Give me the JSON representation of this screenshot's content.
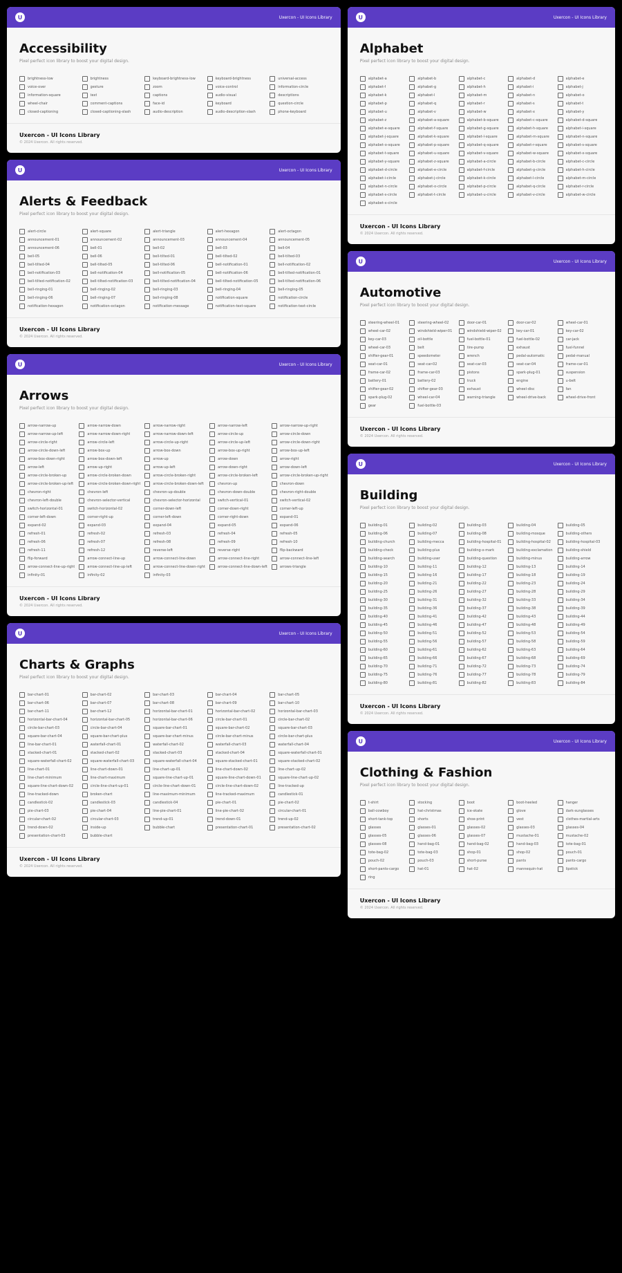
{
  "brand": "Uxercon - UI Icons Library",
  "sub": "Pixel perfect icon library to boost your digital design.",
  "footer_title": "Uxercon - UI Icons Library",
  "footer_copy": "© 2024 Uxercon. All rights reserved.",
  "panels": [
    {
      "title": "Accessibility",
      "items": [
        "brightness-low",
        "brightness",
        "keyboard-brightness-low",
        "keyboard-brightness",
        "universal-access",
        "voice-over",
        "gesture",
        "zoom",
        "voice-control",
        "information-circle",
        "information-square",
        "text",
        "captions",
        "audio-visual",
        "descriptions",
        "wheel-chair",
        "comment-captions",
        "face-id",
        "keyboard",
        "question-circle",
        "closed-captioning",
        "closed-captioning-slash",
        "audio-description",
        "audio-description-slash",
        "phone-keyboard"
      ]
    },
    {
      "title": "Alerts & Feedback",
      "items": [
        "alert-circle",
        "alert-square",
        "alert-triangle",
        "alert-hexagon",
        "alert-octagon",
        "announcement-01",
        "announcement-02",
        "announcement-03",
        "announcement-04",
        "announcement-05",
        "announcement-06",
        "bell-01",
        "bell-02",
        "bell-03",
        "bell-04",
        "bell-05",
        "bell-06",
        "bell-tilted-01",
        "bell-tilted-02",
        "bell-tilted-03",
        "bell-tilted-04",
        "bell-tilted-05",
        "bell-tilted-06",
        "bell-notification-01",
        "bell-notification-02",
        "bell-notification-03",
        "bell-notification-04",
        "bell-notification-05",
        "bell-notification-06",
        "bell-tilted-notification-01",
        "bell-tilted-notification-02",
        "bell-tilted-notification-03",
        "bell-tilted-notification-04",
        "bell-tilted-notification-05",
        "bell-tilted-notification-06",
        "bell-ringing-01",
        "bell-ringing-02",
        "bell-ringing-03",
        "bell-ringing-04",
        "bell-ringing-05",
        "bell-ringing-06",
        "bell-ringing-07",
        "bell-ringing-08",
        "notification-square",
        "notification-circle",
        "notification-hexagon",
        "notification-octagon",
        "notification-message",
        "notification-text-square",
        "notification-text-circle"
      ]
    },
    {
      "title": "Arrows",
      "items": [
        "arrow-narrow-up",
        "arrow-narrow-down",
        "arrow-narrow-right",
        "arrow-narrow-left",
        "arrow-narrow-up-right",
        "arrow-narrow-up-left",
        "arrow-narrow-down-right",
        "arrow-narrow-down-left",
        "arrow-circle-up",
        "arrow-circle-down",
        "arrow-circle-right",
        "arrow-circle-left",
        "arrow-circle-up-right",
        "arrow-circle-up-left",
        "arrow-circle-down-right",
        "arrow-circle-down-left",
        "arrow-box-up",
        "arrow-box-down",
        "arrow-box-up-right",
        "arrow-box-up-left",
        "arrow-box-down-right",
        "arrow-box-down-left",
        "arrow-up",
        "arrow-down",
        "arrow-right",
        "arrow-left",
        "arrow-up-right",
        "arrow-up-left",
        "arrow-down-right",
        "arrow-down-left",
        "arrow-circle-broken-up",
        "arrow-circle-broken-down",
        "arrow-circle-broken-right",
        "arrow-circle-broken-left",
        "arrow-circle-broken-up-right",
        "arrow-circle-broken-up-left",
        "arrow-circle-broken-down-right",
        "arrow-circle-broken-down-left",
        "chevron-up",
        "chevron-down",
        "chevron-right",
        "chevron-left",
        "chevron-up-double",
        "chevron-down-double",
        "chevron-right-double",
        "chevron-left-double",
        "chevron-selector-vertical",
        "chevron-selector-horizontal",
        "switch-vertical-01",
        "switch-vertical-02",
        "switch-horizontal-01",
        "switch-horizontal-02",
        "corner-down-left",
        "corner-down-right",
        "corner-left-up",
        "corner-left-down",
        "corner-right-up",
        "corner-left-down",
        "corner-right-down",
        "expand-01",
        "expand-02",
        "expand-03",
        "expand-04",
        "expand-05",
        "expand-06",
        "refresh-01",
        "refresh-02",
        "refresh-03",
        "refresh-04",
        "refresh-05",
        "refresh-06",
        "refresh-07",
        "refresh-08",
        "refresh-09",
        "refresh-10",
        "refresh-11",
        "refresh-12",
        "reverse-left",
        "reverse-right",
        "flip-backward",
        "flip-forward",
        "arrow-connect-line-up",
        "arrow-connect-line-down",
        "arrow-connect-line-right",
        "arrow-connect-line-left",
        "arrow-connect-line-up-right",
        "arrow-connect-line-up-left",
        "arrow-connect-line-down-right",
        "arrow-connect-line-down-left",
        "arrows-triangle",
        "infinity-01",
        "infinity-02",
        "infinity-03"
      ]
    },
    {
      "title": "Charts & Graphs",
      "items": [
        "bar-chart-01",
        "bar-chart-02",
        "bar-chart-03",
        "bar-chart-04",
        "bar-chart-05",
        "bar-chart-06",
        "bar-chart-07",
        "bar-chart-08",
        "bar-chart-09",
        "bar-chart-10",
        "bar-chart-11",
        "bar-chart-12",
        "horizontal-bar-chart-01",
        "horizontal-bar-chart-02",
        "horizontal-bar-chart-03",
        "horizontal-bar-chart-04",
        "horizontal-bar-chart-05",
        "horizontal-bar-chart-06",
        "circle-bar-chart-01",
        "circle-bar-chart-02",
        "circle-bar-chart-03",
        "circle-bar-chart-04",
        "square-bar-chart-01",
        "square-bar-chart-02",
        "square-bar-chart-03",
        "square-bar-chart-04",
        "square-bar-chart-plus",
        "square-bar-chart-minus",
        "circle-bar-chart-minus",
        "circle-bar-chart-plus",
        "line-bar-chart-01",
        "waterfall-chart-01",
        "waterfall-chart-02",
        "waterfall-chart-03",
        "waterfall-chart-04",
        "stacked-chart-01",
        "stacked-chart-02",
        "stacked-chart-03",
        "stacked-chart-04",
        "square-waterfall-chart-01",
        "square-waterfall-chart-02",
        "square-waterfall-chart-03",
        "square-waterfall-chart-04",
        "square-stacked-chart-01",
        "square-stacked-chart-02",
        "line-chart-01",
        "line-chart-down-01",
        "line-chart-up-01",
        "line-chart-down-02",
        "line-chart-up-02",
        "line-chart-minimum",
        "line-chart-maximum",
        "square-line-chart-up-01",
        "square-line-chart-down-01",
        "square-line-chart-up-02",
        "square-line-chart-down-02",
        "circle-line-chart-up-01",
        "circle-line-chart-down-01",
        "circle-line-chart-down-02",
        "line-tracked-up",
        "line-tracked-down",
        "broken-chart",
        "line-maximum-minimum",
        "line-tracked-maximum",
        "candlestick-01",
        "candlestick-02",
        "candlestick-03",
        "candlestick-04",
        "pie-chart-01",
        "pie-chart-02",
        "pie-chart-03",
        "pie-chart-04",
        "line-pie-chart-01",
        "line-pie-chart-02",
        "circular-chart-01",
        "circular-chart-02",
        "circular-chart-03",
        "trend-up-01",
        "trend-down-01",
        "trend-up-02",
        "trend-down-02",
        "inside-up",
        "bubble-chart",
        "presentation-chart-01",
        "presentation-chart-02",
        "presentation-chart-03",
        "bubble-chart"
      ]
    },
    {
      "title": "Alphabet",
      "items": [
        "alphabet-a",
        "alphabet-b",
        "alphabet-c",
        "alphabet-d",
        "alphabet-e",
        "alphabet-f",
        "alphabet-g",
        "alphabet-h",
        "alphabet-i",
        "alphabet-j",
        "alphabet-k",
        "alphabet-l",
        "alphabet-m",
        "alphabet-n",
        "alphabet-o",
        "alphabet-p",
        "alphabet-q",
        "alphabet-r",
        "alphabet-s",
        "alphabet-t",
        "alphabet-u",
        "alphabet-v",
        "alphabet-w",
        "alphabet-x",
        "alphabet-y",
        "alphabet-z",
        "alphabet-a-square",
        "alphabet-b-square",
        "alphabet-c-square",
        "alphabet-d-square",
        "alphabet-e-square",
        "alphabet-f-square",
        "alphabet-g-square",
        "alphabet-h-square",
        "alphabet-i-square",
        "alphabet-j-square",
        "alphabet-k-square",
        "alphabet-l-square",
        "alphabet-m-square",
        "alphabet-n-square",
        "alphabet-o-square",
        "alphabet-p-square",
        "alphabet-q-square",
        "alphabet-r-square",
        "alphabet-s-square",
        "alphabet-t-square",
        "alphabet-u-square",
        "alphabet-v-square",
        "alphabet-w-square",
        "alphabet-x-square",
        "alphabet-y-square",
        "alphabet-z-square",
        "alphabet-a-circle",
        "alphabet-b-circle",
        "alphabet-c-circle",
        "alphabet-d-circle",
        "alphabet-e-circle",
        "alphabet-f-circle",
        "alphabet-g-circle",
        "alphabet-h-circle",
        "alphabet-i-circle",
        "alphabet-j-circle",
        "alphabet-k-circle",
        "alphabet-l-circle",
        "alphabet-m-circle",
        "alphabet-n-circle",
        "alphabet-o-circle",
        "alphabet-p-circle",
        "alphabet-q-circle",
        "alphabet-r-circle",
        "alphabet-s-circle",
        "alphabet-t-circle",
        "alphabet-u-circle",
        "alphabet-v-circle",
        "alphabet-w-circle",
        "alphabet-x-circle"
      ]
    },
    {
      "title": "Automotive",
      "items": [
        "steering-wheel-01",
        "steering-wheel-02",
        "door-car-01",
        "door-car-02",
        "wheel-car-01",
        "wheel-car-02",
        "windshield-wiper-01",
        "windshield-wiper-02",
        "key-car-01",
        "key-car-02",
        "key-car-03",
        "oil-bottle",
        "fuel-bottle-01",
        "fuel-bottle-02",
        "car-jack",
        "wheel-car-03",
        "belt",
        "tire-pump",
        "exhaust",
        "fuel-funnel",
        "shifter-gear-01",
        "speedometer",
        "wrench",
        "pedal-automatic",
        "pedal-manual",
        "seat-car-01",
        "seat-car-02",
        "seat-car-03",
        "seat-car-04",
        "frame-car-01",
        "frame-car-02",
        "frame-car-03",
        "pistons",
        "spark-plug-01",
        "suspension",
        "battery-01",
        "battery-02",
        "truck",
        "engine",
        "u-belt",
        "shifter-gear-02",
        "shifter-gear-03",
        "exhaust",
        "wheel-disc",
        "fan",
        "spark-plug-02",
        "wheel-car-04",
        "warning-triangle",
        "wheel-drive-back",
        "wheel-drive-front",
        "gear",
        "fuel-bottle-03"
      ]
    },
    {
      "title": "Building",
      "items": [
        "building-01",
        "building-02",
        "building-03",
        "building-04",
        "building-05",
        "building-06",
        "building-07",
        "building-08",
        "building-mosque",
        "building-others",
        "building-church",
        "building-mecca",
        "building-hospital-01",
        "building-hospital-02",
        "building-hospital-03",
        "building-check",
        "building-plus",
        "building-x-mark",
        "building-exclamation",
        "building-shield",
        "building-search",
        "building-user",
        "building-question",
        "building-minus",
        "building-arrow",
        "building-10",
        "building-11",
        "building-12",
        "building-13",
        "building-14",
        "building-15",
        "building-16",
        "building-17",
        "building-18",
        "building-19",
        "building-20",
        "building-21",
        "building-22",
        "building-23",
        "building-24",
        "building-25",
        "building-26",
        "building-27",
        "building-28",
        "building-29",
        "building-30",
        "building-31",
        "building-32",
        "building-33",
        "building-34",
        "building-35",
        "building-36",
        "building-37",
        "building-38",
        "building-39",
        "building-40",
        "building-41",
        "building-42",
        "building-43",
        "building-44",
        "building-45",
        "building-46",
        "building-47",
        "building-48",
        "building-49",
        "building-50",
        "building-51",
        "building-52",
        "building-53",
        "building-54",
        "building-55",
        "building-56",
        "building-57",
        "building-58",
        "building-59",
        "building-60",
        "building-61",
        "building-62",
        "building-63",
        "building-64",
        "building-65",
        "building-66",
        "building-67",
        "building-68",
        "building-69",
        "building-70",
        "building-71",
        "building-72",
        "building-73",
        "building-74",
        "building-75",
        "building-76",
        "building-77",
        "building-78",
        "building-79",
        "building-80",
        "building-81",
        "building-82",
        "building-83",
        "building-84"
      ]
    },
    {
      "title": "Clothing & Fashion",
      "items": [
        "t-shirt",
        "stocking",
        "boot",
        "boot-heeled",
        "hanger",
        "ball-cowboy",
        "hat-christmas",
        "ice-skate",
        "glove",
        "dark-sunglasses",
        "short-tank-top",
        "shorts",
        "shoe-print",
        "vest",
        "clothes-martial-arts",
        "glasses",
        "glasses-01",
        "glasses-02",
        "glasses-03",
        "glasses-04",
        "glasses-05",
        "glasses-06",
        "glasses-07",
        "mustache-01",
        "mustache-02",
        "glasses-08",
        "hand-bag-01",
        "hand-bag-02",
        "hand-bag-03",
        "tote-bag-01",
        "tote-bag-02",
        "tote-bag-03",
        "shop-01",
        "shop-02",
        "pouch-01",
        "pouch-02",
        "pouch-03",
        "short-purse",
        "pants",
        "pants-cargo",
        "short-pants-cargo",
        "hat-01",
        "hat-02",
        "mannequin-hat",
        "lipstick",
        "ring"
      ]
    }
  ]
}
